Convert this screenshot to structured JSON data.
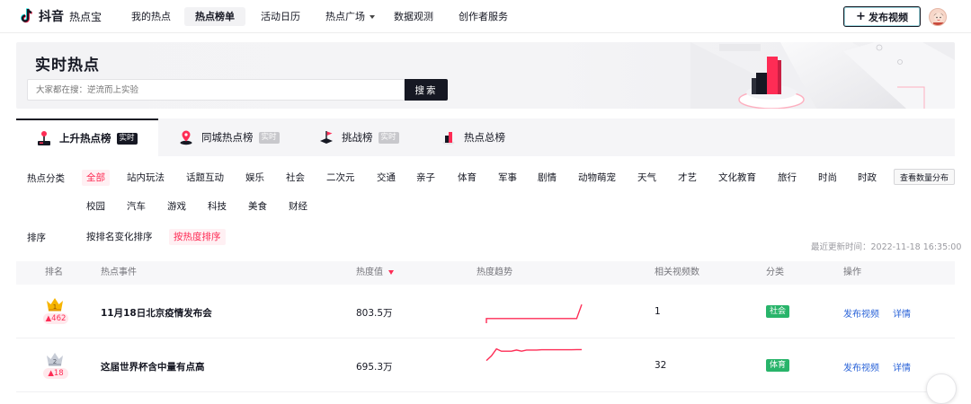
{
  "app": {
    "logo_text": "抖音",
    "product": "热点宝"
  },
  "nav": [
    {
      "label": "我的热点",
      "active": false
    },
    {
      "label": "热点榜单",
      "active": true
    },
    {
      "label": "活动日历",
      "active": false
    },
    {
      "label": "热点广场",
      "active": false,
      "dropdown": true
    },
    {
      "label": "数据观测",
      "active": false
    },
    {
      "label": "创作者服务",
      "active": false
    }
  ],
  "header": {
    "publish_label": "发布视频"
  },
  "banner": {
    "title": "实时热点",
    "search_placeholder": "大家都在搜：逆流而上实验",
    "search_button": "搜索"
  },
  "tabs": [
    {
      "label": "上升热点榜",
      "tag": "实时",
      "active": true
    },
    {
      "label": "同城热点榜",
      "tag": "实时",
      "active": false
    },
    {
      "label": "挑战榜",
      "tag": "实时",
      "active": false
    },
    {
      "label": "热点总榜",
      "tag": "",
      "active": false
    }
  ],
  "filters": {
    "category_label": "热点分类",
    "categories_row1": [
      "全部",
      "站内玩法",
      "话题互动",
      "娱乐",
      "社会",
      "二次元",
      "交通",
      "亲子",
      "体育",
      "军事",
      "剧情",
      "动物萌宠",
      "天气",
      "才艺",
      "文化教育",
      "旅行",
      "时尚",
      "时政"
    ],
    "categories_row2": [
      "校园",
      "汽车",
      "游戏",
      "科技",
      "美食",
      "财经"
    ],
    "active_category": "全部",
    "count_button": "查看数量分布",
    "sort_label": "排序",
    "sort_options": [
      "按排名变化排序",
      "按热度排序"
    ],
    "active_sort": "按热度排序",
    "update_time": "最近更新时间：2022-11-18 16:35:00"
  },
  "table": {
    "headers": {
      "rank": "排名",
      "event": "热点事件",
      "heat": "热度值",
      "trend": "热度趋势",
      "videos": "相关视频数",
      "category": "分类",
      "action": "操作"
    },
    "rows": [
      {
        "rank": "1",
        "change": "462",
        "title": "11月18日北京疫情发布会",
        "heat": "803.5万",
        "videos": "1",
        "category": "社会",
        "publish": "发布视频",
        "detail": "详情",
        "trend": [
          2,
          2,
          2,
          2,
          2,
          2,
          2,
          2,
          2,
          2,
          2,
          2,
          2,
          2,
          2,
          2,
          2,
          2,
          2,
          8
        ]
      },
      {
        "rank": "2",
        "change": "18",
        "title": "这届世界杯含中量有点高",
        "heat": "695.3万",
        "videos": "32",
        "category": "体育",
        "publish": "发布视频",
        "detail": "详情",
        "trend": [
          4,
          6,
          9,
          8,
          8,
          8,
          8.5,
          8,
          8.5,
          8.5,
          8.5,
          8.6,
          8.6,
          8.6,
          8.6,
          8.6,
          8.6,
          8.6,
          8.7,
          8.7
        ]
      }
    ]
  },
  "colors": {
    "accent": "#fe2c55",
    "link": "#2a63d8",
    "category_green": "#28b46a"
  }
}
